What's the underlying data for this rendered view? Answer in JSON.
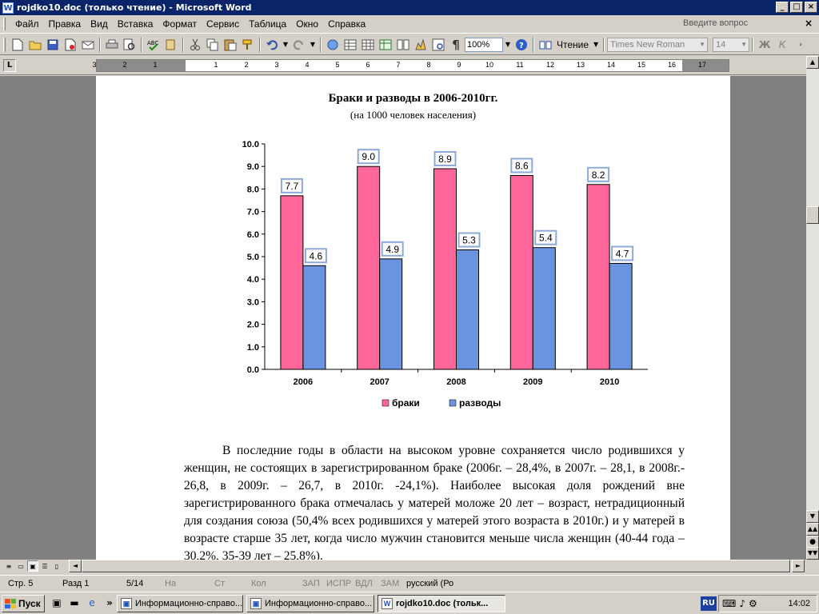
{
  "window": {
    "title": "rojdko10.doc (только чтение) - Microsoft Word",
    "controls": [
      "_",
      "□",
      "×"
    ]
  },
  "menu": {
    "items": [
      "Файл",
      "Правка",
      "Вид",
      "Вставка",
      "Формат",
      "Сервис",
      "Таблица",
      "Окно",
      "Справка"
    ],
    "ask_placeholder": "Введите вопрос",
    "close": "×"
  },
  "toolbar": {
    "zoom": "100%",
    "reading_label": "Чтение",
    "font_name": "Times New Roman",
    "font_size": "14",
    "bold": "Ж",
    "italic": "К",
    "pilcrow": "¶",
    "icons": [
      "new-icon",
      "open-icon",
      "save-icon",
      "permission-icon",
      "email-icon",
      "print-icon",
      "print-preview-icon",
      "spelling-icon",
      "research-icon",
      "cut-icon",
      "copy-icon",
      "paste-icon",
      "format-painter-icon",
      "undo-icon",
      "redo-icon",
      "hyperlink-icon",
      "tables-borders-icon",
      "insert-table-icon",
      "insert-excel-icon",
      "columns-icon",
      "drawing-icon",
      "document-map-icon",
      "show-hide-icon",
      "help-icon"
    ]
  },
  "ruler": {
    "numbers": [
      "3",
      "2",
      "1",
      "1",
      "2",
      "3",
      "4",
      "5",
      "6",
      "7",
      "8",
      "9",
      "10",
      "11",
      "12",
      "13",
      "14",
      "15",
      "16",
      "17"
    ]
  },
  "chart_data": {
    "type": "bar",
    "title": "Браки и разводы в 2006-2010гг.",
    "subtitle": "(на 1000 человек населения)",
    "categories": [
      "2006",
      "2007",
      "2008",
      "2009",
      "2010"
    ],
    "series": [
      {
        "name": "браки",
        "color": "#ff6699",
        "values": [
          7.7,
          9.0,
          8.9,
          8.6,
          8.2
        ]
      },
      {
        "name": "разводы",
        "color": "#6a93e0",
        "values": [
          4.6,
          4.9,
          5.3,
          5.4,
          4.7
        ]
      }
    ],
    "ylim": [
      0,
      10
    ],
    "yticks": [
      "0.0",
      "1.0",
      "2.0",
      "3.0",
      "4.0",
      "5.0",
      "6.0",
      "7.0",
      "8.0",
      "9.0",
      "10.0"
    ],
    "legend_position": "bottom",
    "grid": false
  },
  "document": {
    "paragraph": "В последние годы в области на высоком уровне сохраняется число родившихся у женщин, не состоящих в зарегистрированном браке (2006г. – 28,4%, в 2007г. – 28,1, в 2008г.- 26,8, в 2009г. – 26,7, в 2010г. -24,1%). Наиболее высокая доля рождений вне зарегистрированного брака отмечалась у матерей моложе 20 лет – возраст, нетрадиционный для создания союза (50,4%  всех родившихся у матерей этого возраста в 2010г.) и у матерей в возрасте старше 35 лет, когда число мужчин становится меньше числа женщин (40-44 года – 30,2%, 35-39 лет – 25,8%)."
  },
  "status": {
    "page": "Стр. 5",
    "section": "Разд 1",
    "pages": "5/14",
    "at": "На",
    "line": "Ст",
    "col": "Кол",
    "rec": "ЗАП",
    "trk": "ИСПР",
    "ext": "ВДЛ",
    "ovr": "ЗАМ",
    "language": "русский (Ро"
  },
  "taskbar": {
    "start": "Пуск",
    "tasks": [
      "Информационно-справо...",
      "Информационно-справо...",
      "rojdko10.doc (тольк..."
    ],
    "lang": "RU",
    "time": "14:02",
    "more": "»"
  }
}
